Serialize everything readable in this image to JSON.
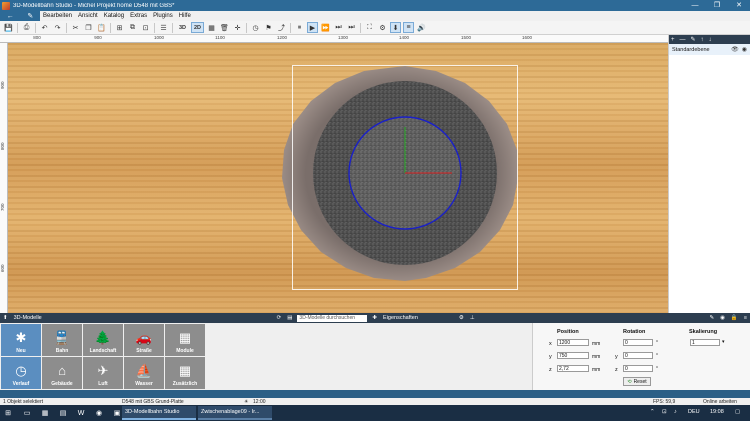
{
  "window": {
    "title": "3D-Modellbahn Studio - Michel Projekt home D548 mit GBS*",
    "minimize": "—",
    "maximize": "❐",
    "close": "✕"
  },
  "menu": {
    "file_icon_back": "←",
    "file_icon_edit": "✎",
    "items": [
      "Bearbeiten",
      "Ansicht",
      "Katalog",
      "Extras",
      "Plugins",
      "Hilfe"
    ]
  },
  "toolbar": {
    "view3d": "3D",
    "view2d": "2D"
  },
  "ruler": {
    "top": [
      "800",
      "900",
      "1000",
      "1100",
      "1200",
      "1300",
      "1400",
      "1500",
      "1600"
    ],
    "left": [
      "900",
      "800",
      "700",
      "600"
    ]
  },
  "layers": {
    "header_icons": [
      "+",
      "—",
      "✎",
      "↑",
      "↓"
    ],
    "items": [
      {
        "name": "Standardebene"
      }
    ]
  },
  "bottom_bar": {
    "left_label": "3D-Modelle",
    "search_placeholder": "3D-Modelle durchsuchen",
    "right_label": "Eigenschaften"
  },
  "models": {
    "tiles": [
      {
        "label": "Neu",
        "icon": "✱"
      },
      {
        "label": "Bahn",
        "icon": "🚆"
      },
      {
        "label": "Landschaft",
        "icon": "🌲"
      },
      {
        "label": "Straße",
        "icon": "🚗"
      },
      {
        "label": "Module",
        "icon": "▦"
      },
      {
        "label": "Verlauf",
        "icon": "◷"
      },
      {
        "label": "Gebäude",
        "icon": "⌂"
      },
      {
        "label": "Luft",
        "icon": "✈"
      },
      {
        "label": "Wasser",
        "icon": "⛵"
      },
      {
        "label": "Zusätzlich",
        "icon": "▦"
      }
    ]
  },
  "properties": {
    "position_label": "Position",
    "rotation_label": "Rotation",
    "scale_label": "Skalierung",
    "x": "1200",
    "y": "750",
    "z": "2,72",
    "unit": "mm",
    "rot_x": "0",
    "rot_y": "0",
    "rot_z": "0",
    "deg": "°",
    "scale": "1",
    "reset": "Reset",
    "axis_x": "x",
    "axis_y": "y",
    "axis_z": "z"
  },
  "status": {
    "selection": "1 Objekt selektiert",
    "layer": "D548 mit GBS Grund-Platte",
    "time": "12:00",
    "fps": "FPS: 59,9",
    "online": "Online arbeiten"
  },
  "taskbar": {
    "tasks": [
      "3D-Modellbahn Studio",
      "Zwischenablage09 - Ir..."
    ],
    "lang": "DEU",
    "clock": "19:08"
  },
  "colors": {
    "accent": "#2d6a97",
    "panel_dark": "#2d3e50",
    "tile_grey": "#8d8d8d",
    "tile_active": "#5b8ec0"
  }
}
